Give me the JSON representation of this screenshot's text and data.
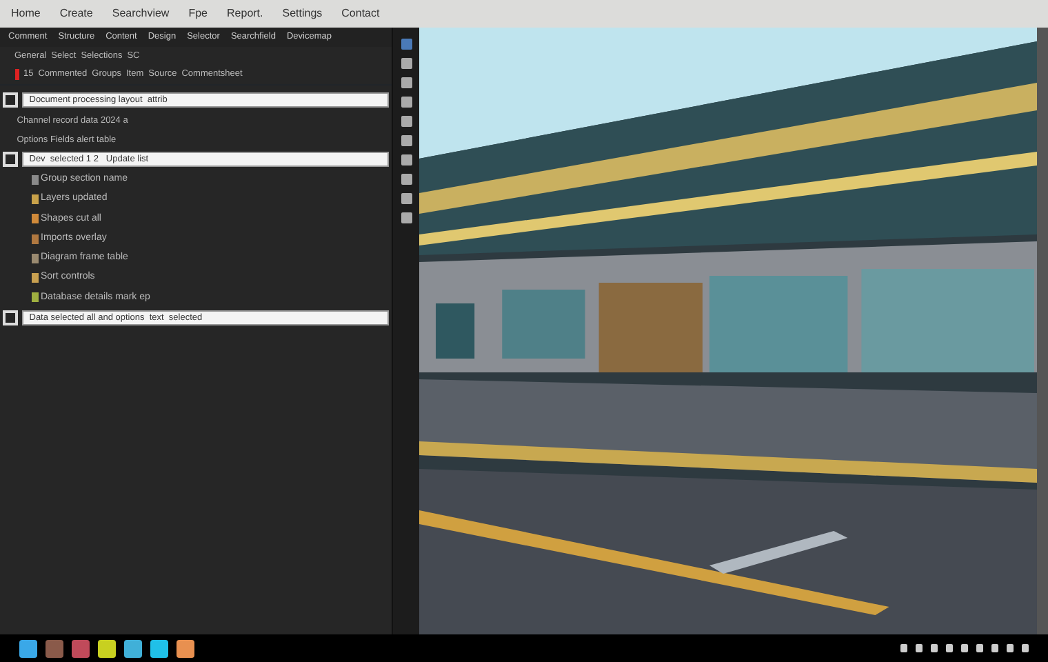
{
  "menu": [
    "Home",
    "Create",
    "Searchview",
    "Fpe",
    "Report.",
    "Settings",
    "Contact"
  ],
  "toolbar_tabs": [
    "Comment",
    "Structure",
    "Content",
    "Design",
    "Selector",
    "Searchfield",
    "Devicemap"
  ],
  "filter_bar": {
    "items": [
      "General",
      "Select",
      "Selections",
      "SC"
    ]
  },
  "header_row": [
    "15",
    "Commented",
    "Groups",
    "Item",
    "Source",
    "Commentsheet"
  ],
  "entries": [
    {
      "value": "Document processing layout  attrib",
      "notes": [
        "Channel record data  2024 a",
        "Options    Fields alert table"
      ]
    },
    {
      "value": "Dev  selected 1 2   Update list",
      "children": [
        {
          "label": "Group section  name",
          "color": "#8a8a8a"
        },
        {
          "label": "Layers updated",
          "color": "#c9a24a"
        },
        {
          "label": "Shapes cut  all",
          "color": "#d08a3a"
        },
        {
          "label": "Imports  overlay",
          "color": "#b07840"
        },
        {
          "label": "Diagram frame  table",
          "color": "#9a8a70"
        },
        {
          "label": "Sort controls",
          "color": "#c8a050"
        },
        {
          "label": "Database details mark  ep",
          "color": "#a0b040"
        }
      ]
    },
    {
      "value": "Data selected all and options  text  selected"
    }
  ],
  "taskbar": [
    {
      "color": "#3aa8e8"
    },
    {
      "color": "#8a5a4a"
    },
    {
      "color": "#c04a5a"
    },
    {
      "color": "#c8d020"
    },
    {
      "color": "#40b0d8"
    },
    {
      "color": "#20c0e8"
    },
    {
      "color": "#e89050"
    }
  ]
}
